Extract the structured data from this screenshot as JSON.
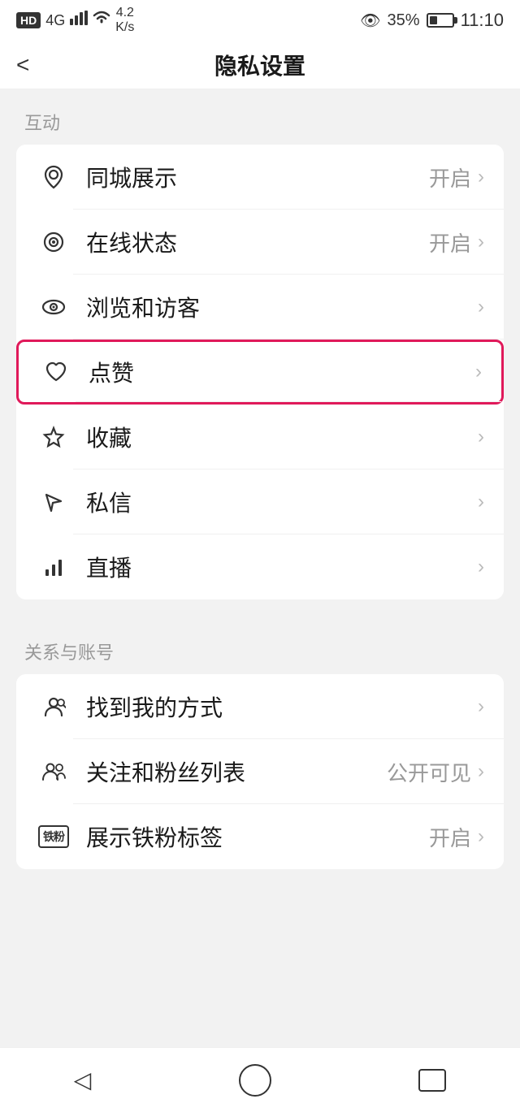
{
  "statusBar": {
    "left": {
      "hd": "HD",
      "signal4g": "4G",
      "wifi": "4.2\nK/s"
    },
    "right": {
      "eye": "👁",
      "battery": "35%",
      "time": "11:10"
    }
  },
  "nav": {
    "backLabel": "<",
    "title": "隐私设置"
  },
  "sections": [
    {
      "label": "互动",
      "items": [
        {
          "id": "tongcheng",
          "icon": "location",
          "label": "同城展示",
          "value": "开启",
          "arrow": ">"
        },
        {
          "id": "online",
          "icon": "online",
          "label": "在线状态",
          "value": "开启",
          "arrow": ">"
        },
        {
          "id": "browse",
          "icon": "eye",
          "label": "浏览和访客",
          "value": "",
          "arrow": ">"
        },
        {
          "id": "like",
          "icon": "heart",
          "label": "点赞",
          "value": "",
          "arrow": ">",
          "highlighted": true
        },
        {
          "id": "collect",
          "icon": "star",
          "label": "收藏",
          "value": "",
          "arrow": ">"
        },
        {
          "id": "message",
          "icon": "send",
          "label": "私信",
          "value": "",
          "arrow": ">"
        },
        {
          "id": "live",
          "icon": "bar",
          "label": "直播",
          "value": "",
          "arrow": ">"
        }
      ]
    },
    {
      "label": "关系与账号",
      "items": [
        {
          "id": "findme",
          "icon": "person",
          "label": "找到我的方式",
          "value": "",
          "arrow": ">"
        },
        {
          "id": "follow",
          "icon": "persons",
          "label": "关注和粉丝列表",
          "value": "公开可见",
          "arrow": ">"
        },
        {
          "id": "tiefen",
          "icon": "tiefen",
          "label": "展示铁粉标签",
          "value": "开启",
          "arrow": ">"
        }
      ]
    }
  ],
  "bottomNav": {
    "back": "◁",
    "home": "○",
    "recent": "▭"
  }
}
